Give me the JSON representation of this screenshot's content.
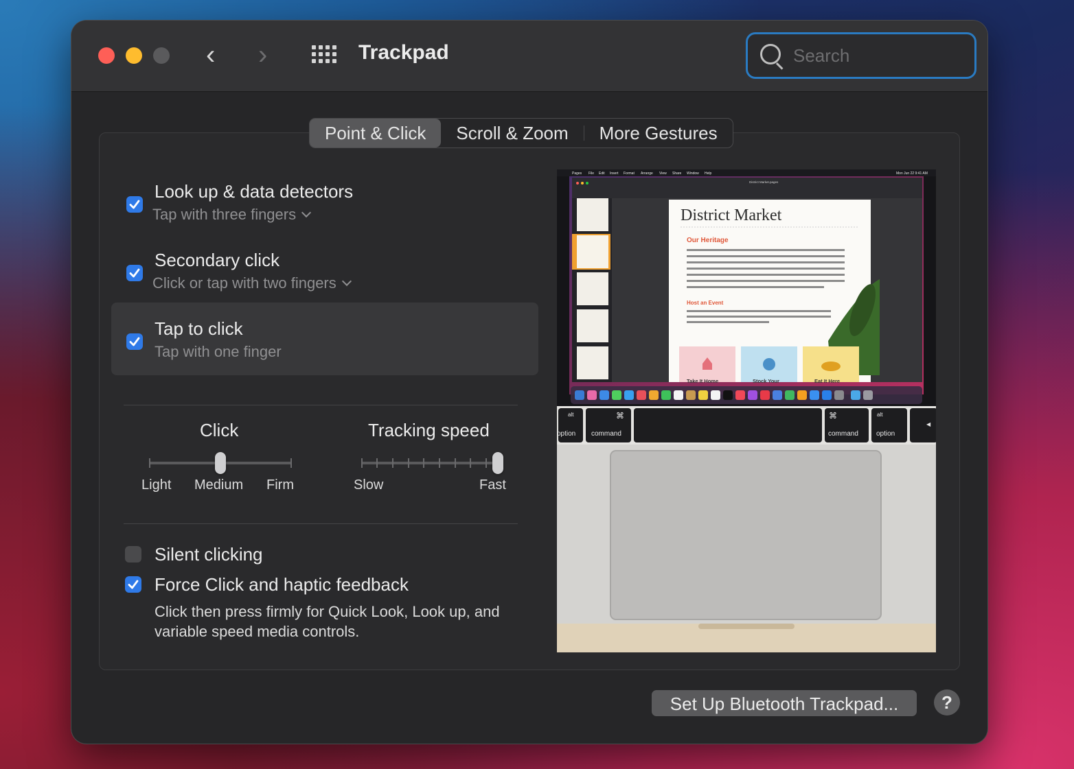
{
  "window": {
    "title": "Trackpad"
  },
  "search": {
    "placeholder": "Search",
    "value": ""
  },
  "tabs": [
    {
      "label": "Point & Click",
      "active": true
    },
    {
      "label": "Scroll & Zoom",
      "active": false
    },
    {
      "label": "More Gestures",
      "active": false
    }
  ],
  "options": {
    "lookup": {
      "title": "Look up & data detectors",
      "subtitle": "Tap with three fingers",
      "checked": true
    },
    "secondary": {
      "title": "Secondary click",
      "subtitle": "Click or tap with two fingers",
      "checked": true
    },
    "tap": {
      "title": "Tap to click",
      "subtitle": "Tap with one finger",
      "checked": true
    },
    "silent": {
      "title": "Silent clicking",
      "checked": false
    },
    "force": {
      "title": "Force Click and haptic feedback",
      "checked": true,
      "description": "Click then press firmly for Quick Look, Look up, and variable speed media controls."
    }
  },
  "click_slider": {
    "title": "Click",
    "labels": [
      "Light",
      "Medium",
      "Firm"
    ],
    "value": "Medium"
  },
  "tracking_slider": {
    "title": "Tracking speed",
    "min_label": "Slow",
    "max_label": "Fast",
    "value": 10,
    "steps": 10
  },
  "preview": {
    "doc_title": "District Market",
    "heading1": "Our Heritage",
    "heading2": "Host an Event",
    "cards": [
      "Take It Home",
      "Stock Your",
      "Eat It Here"
    ],
    "keys": [
      "option",
      "command",
      "command",
      "option"
    ],
    "key_alts": [
      "alt",
      "alt"
    ],
    "menu": [
      "Pages",
      "File",
      "Edit",
      "Insert",
      "Format",
      "Arrange",
      "View",
      "Share",
      "Window",
      "Help"
    ],
    "clock": "Mon Jun 22  9:41 AM",
    "doc_name": "District Market.pages"
  },
  "footer": {
    "bluetooth_button": "Set Up Bluetooth Trackpad...",
    "help_button": "?"
  },
  "colors": {
    "accent": "#2f7ae8",
    "search_focus": "#2a7bc2",
    "window_bg": "#262628"
  }
}
